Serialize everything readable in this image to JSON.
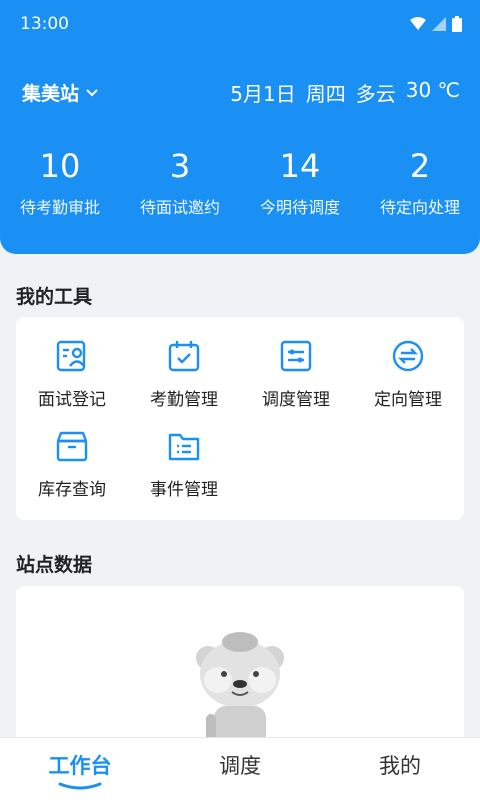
{
  "status_bar": {
    "time": "13:00"
  },
  "header": {
    "station": "集美站",
    "date": "5月1日",
    "weekday": "周四",
    "weather": "多云",
    "temperature": "30 ℃"
  },
  "stats": [
    {
      "value": "10",
      "label": "待考勤审批"
    },
    {
      "value": "3",
      "label": "待面试邀约"
    },
    {
      "value": "14",
      "label": "今明待调度"
    },
    {
      "value": "2",
      "label": "待定向处理"
    }
  ],
  "tools": {
    "title": "我的工具",
    "items": [
      {
        "label": "面试登记",
        "icon": "interview-register-icon"
      },
      {
        "label": "考勤管理",
        "icon": "attendance-calendar-icon"
      },
      {
        "label": "调度管理",
        "icon": "dispatch-sliders-icon"
      },
      {
        "label": "定向管理",
        "icon": "directional-exchange-icon"
      },
      {
        "label": "库存查询",
        "icon": "inventory-box-icon"
      },
      {
        "label": "事件管理",
        "icon": "event-folder-icon"
      }
    ]
  },
  "station_data": {
    "title": "站点数据"
  },
  "tabbar": {
    "items": [
      {
        "label": "工作台"
      },
      {
        "label": "调度"
      },
      {
        "label": "我的"
      }
    ],
    "active": "工作台"
  },
  "colors": {
    "primary": "#1a90f5",
    "background": "#f0f2f5"
  }
}
